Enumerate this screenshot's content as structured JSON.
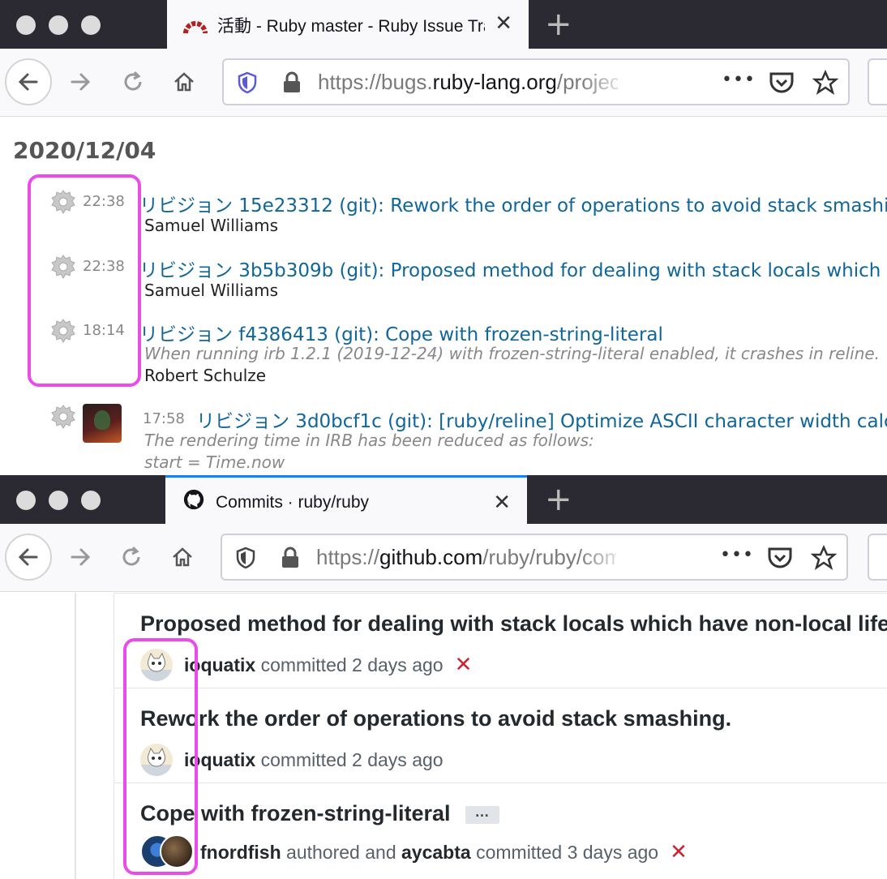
{
  "redmine_window": {
    "tab_title": "活動 - Ruby master - Ruby Issue Tracking System",
    "tab_close": "✕",
    "new_tab": "+",
    "url_prefix": "https://bugs.",
    "url_host": "ruby-lang.org",
    "url_path": "/projects/ruby-master/activity",
    "page_actions": "•••",
    "date_heading": "2020/12/04",
    "entries": [
      {
        "time": "22:38",
        "link": "リビジョン 15e23312 (git): Rework the order of operations to avoid stack smashing.",
        "description": "",
        "author": "Samuel Williams",
        "icon": "gear-icon"
      },
      {
        "time": "22:38",
        "link": "リビジョン 3b5b309b (git): Proposed method for dealing with stack locals which have non-local lifetime.",
        "description": "",
        "author": "Samuel Williams",
        "icon": "gear-icon"
      },
      {
        "time": "18:14",
        "link": "リビジョン f4386413 (git): Cope with frozen-string-literal",
        "description": "When running irb 1.2.1 (2019-12-24) with frozen-string-literal enabled, it crashes in reline.",
        "author": "Robert Schulze",
        "icon": "gear-icon"
      },
      {
        "time": "17:58",
        "link": "リビジョン 3d0bcf1c (git): [ruby/reline] Optimize ASCII character width calculation",
        "description": "The rendering time in IRB has been reduced as follows:",
        "description2": "start = Time.now",
        "author": "",
        "icon": "gear-icon"
      }
    ]
  },
  "github_window": {
    "tab_title": "Commits · ruby/ruby",
    "tab_close": "✕",
    "new_tab": "+",
    "url_prefix": "https://",
    "url_host": "github.com",
    "url_path": "/ruby/ruby/commits/master",
    "page_actions": "•••",
    "commits": [
      {
        "title": "Proposed method for dealing with stack locals which have non-local lifetime.",
        "user": "ioquatix",
        "verb": "committed",
        "when": "2 days ago",
        "status": "✕"
      },
      {
        "title": "Rework the order of operations to avoid stack smashing.",
        "user": "ioquatix",
        "verb": "committed",
        "when": "2 days ago",
        "status": ""
      },
      {
        "title": "Cope with frozen-string-literal",
        "ellipsis": "…",
        "author": "fnordfish",
        "mid": "authored and",
        "committer": "aycabta",
        "verb": "committed",
        "when": "3 days ago",
        "status": "✕"
      }
    ]
  },
  "colors": {
    "highlight": "#e94ce9",
    "redmine_link": "#116699",
    "github_fail": "#cb2431"
  }
}
